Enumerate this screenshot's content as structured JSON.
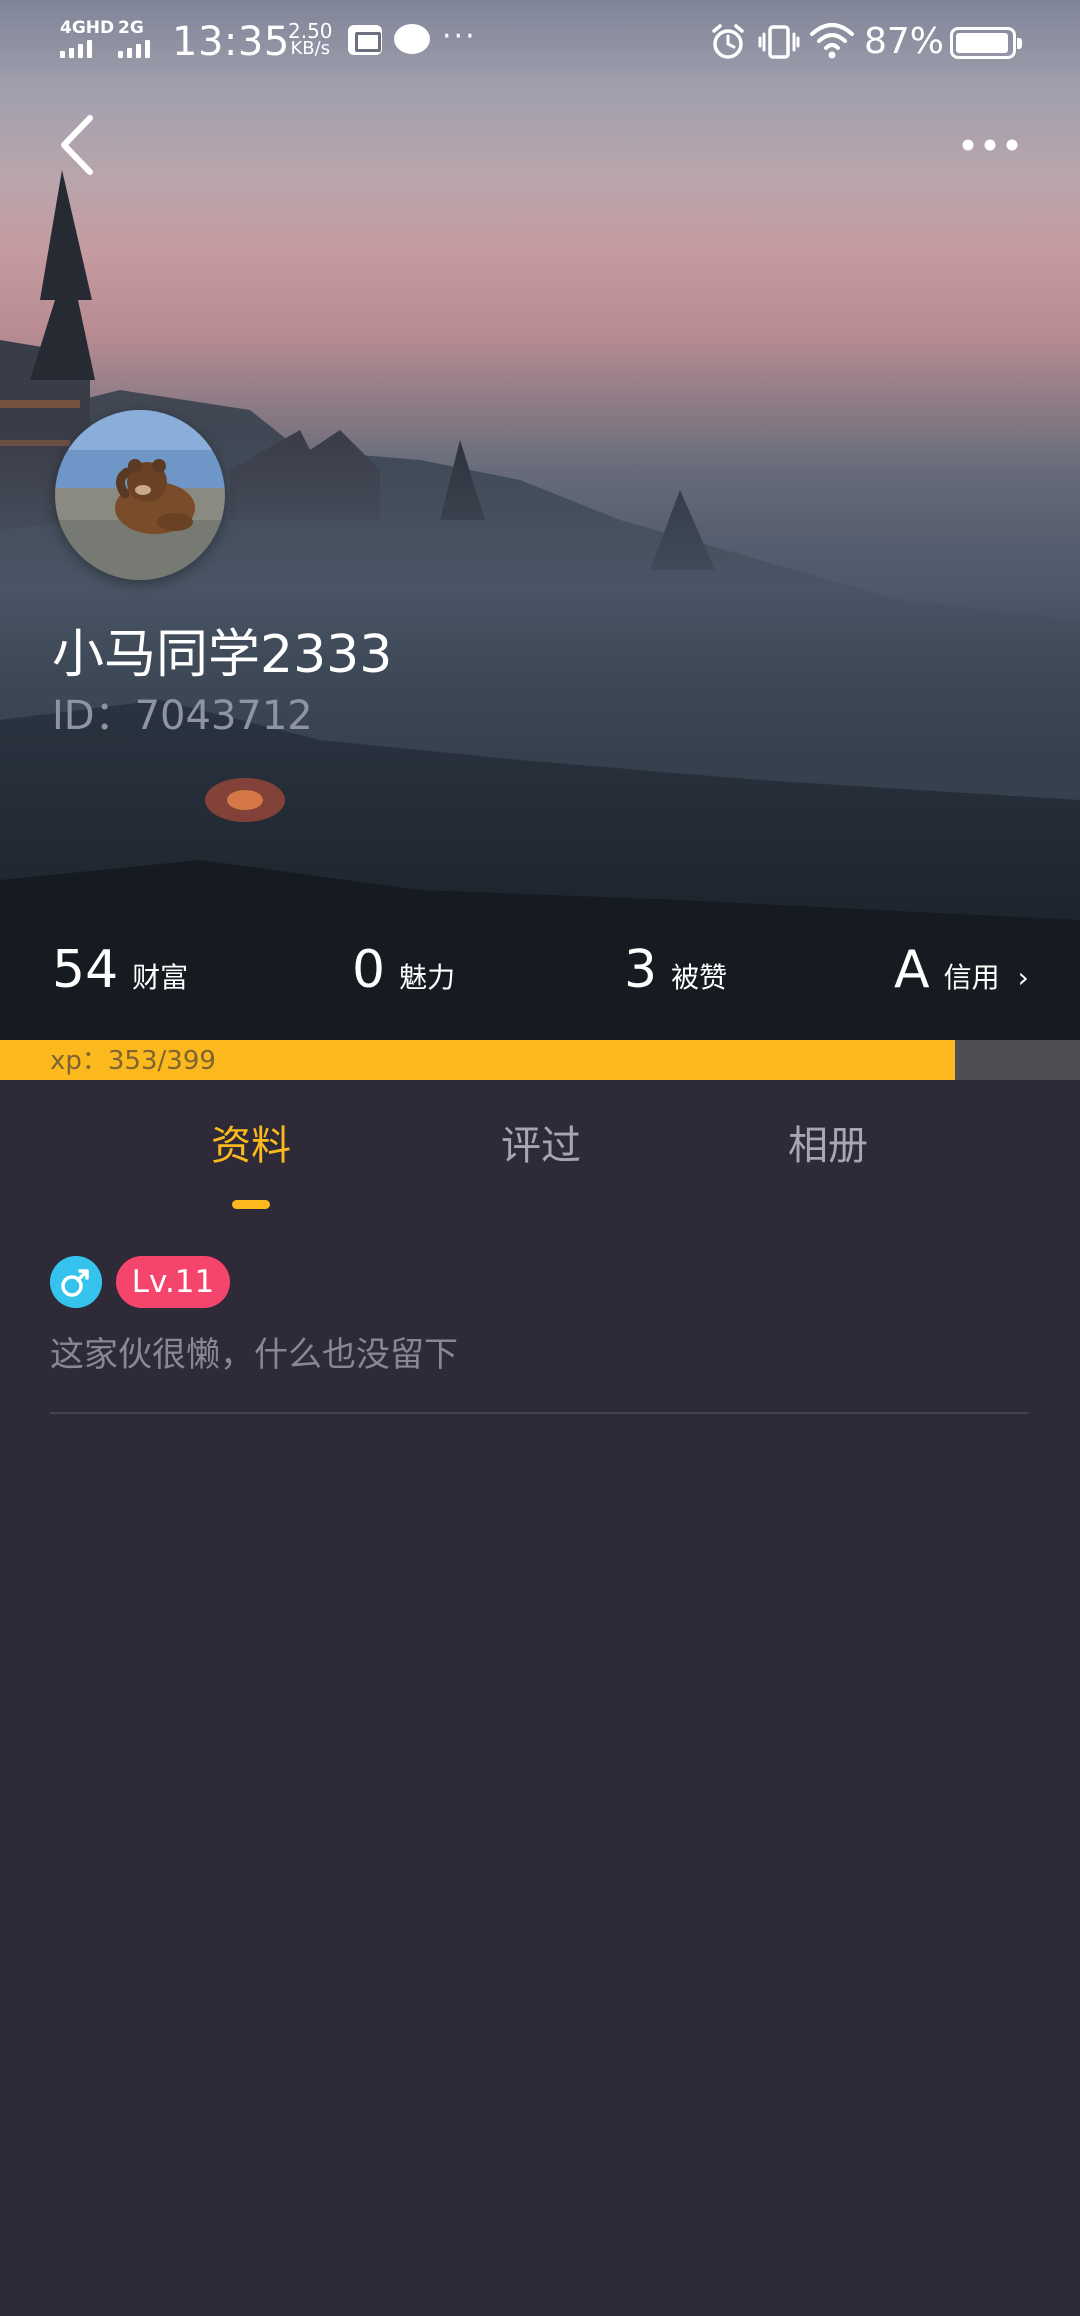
{
  "status_bar": {
    "network_1": "4GHD",
    "network_2": "2G",
    "time": "13:35",
    "speed_value": "2.50",
    "speed_unit": "KB/s",
    "more_indicator": "···",
    "battery_percent": "87%",
    "battery_level": 0.87,
    "icons": [
      "signal-icon",
      "mail-icon",
      "chat-icon",
      "alarm-icon",
      "vibrate-icon",
      "wifi-icon",
      "battery-icon"
    ]
  },
  "nav": {
    "icons": [
      "back-arrow-icon",
      "more-dots-icon"
    ]
  },
  "profile": {
    "username": "小马同学2333",
    "id_text": "ID：7043712"
  },
  "stats": [
    {
      "value": "54",
      "label": "财富"
    },
    {
      "value": "0",
      "label": "魅力"
    },
    {
      "value": "3",
      "label": "被赞"
    },
    {
      "value": "A",
      "label": "信用",
      "chevron": "›"
    }
  ],
  "xp": {
    "text": "xp：353/399",
    "current": 353,
    "max": 399
  },
  "tabs": [
    {
      "label": "资料",
      "active": true
    },
    {
      "label": "评过",
      "active": false
    },
    {
      "label": "相册",
      "active": false
    }
  ],
  "info": {
    "gender_symbol": "♂",
    "level": "Lv.11",
    "bio": "这家伙很懒，什么也没留下"
  },
  "colors": {
    "accent": "#fbb91d",
    "background": "#2e2a37",
    "level_badge": "#f5456d",
    "gender_badge": "#35c3ee"
  }
}
